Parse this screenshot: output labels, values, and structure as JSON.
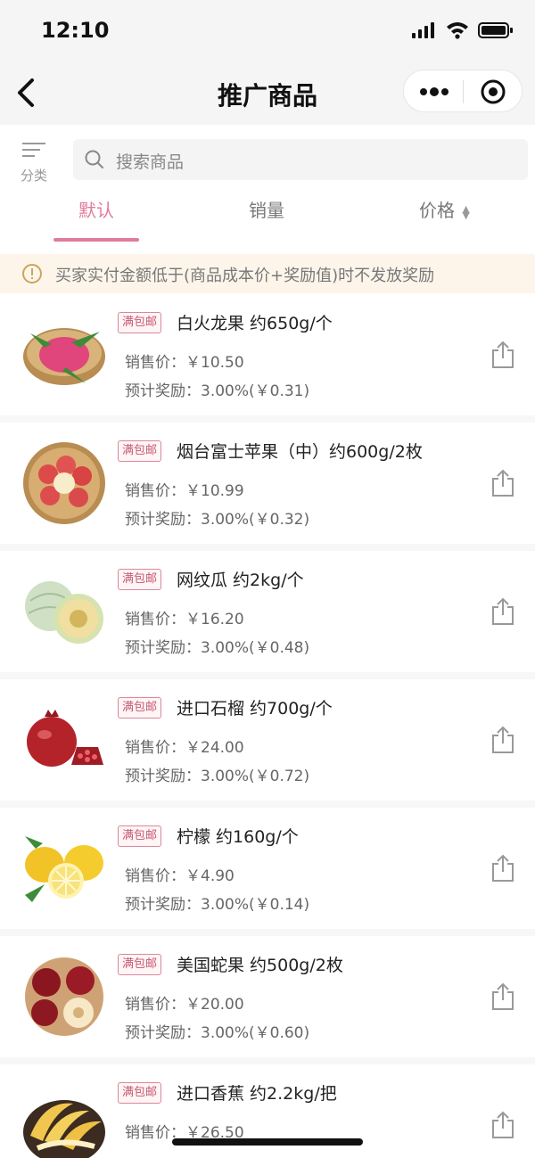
{
  "status_bar": {
    "time": "12:10"
  },
  "nav": {
    "title": "推广商品"
  },
  "filter": {
    "category_label": "分类",
    "search_placeholder": "搜索商品",
    "tabs": [
      {
        "label": "默认",
        "active": true
      },
      {
        "label": "销量",
        "active": false
      },
      {
        "label": "价格",
        "active": false
      }
    ]
  },
  "notice": {
    "text": "买家实付金额低于(商品成本价+奖励值)时不发放奖励"
  },
  "products": [
    {
      "badge": "满包邮",
      "name": "白火龙果 约650g/个",
      "price": "销售价：￥10.50",
      "reward": "预计奖励：3.00%(￥0.31)",
      "icon": "dragon-fruit-icon"
    },
    {
      "badge": "满包邮",
      "name": "烟台富士苹果（中）约600g/2枚",
      "price": "销售价：￥10.99",
      "reward": "预计奖励：3.00%(￥0.32)",
      "icon": "apple-basket-icon"
    },
    {
      "badge": "满包邮",
      "name": "网纹瓜 约2kg/个",
      "price": "销售价：￥16.20",
      "reward": "预计奖励：3.00%(￥0.48)",
      "icon": "melon-icon"
    },
    {
      "badge": "满包邮",
      "name": "进口石榴 约700g/个",
      "price": "销售价：￥24.00",
      "reward": "预计奖励：3.00%(￥0.72)",
      "icon": "pomegranate-icon"
    },
    {
      "badge": "满包邮",
      "name": "柠檬 约160g/个",
      "price": "销售价：￥4.90",
      "reward": "预计奖励：3.00%(￥0.14)",
      "icon": "lemon-icon"
    },
    {
      "badge": "满包邮",
      "name": "美国蛇果 约500g/2枚",
      "price": "销售价：￥20.00",
      "reward": "预计奖励：3.00%(￥0.60)",
      "icon": "red-apple-icon"
    },
    {
      "badge": "满包邮",
      "name": "进口香蕉 约2.2kg/把",
      "price": "销售价：￥26.50",
      "reward": "",
      "icon": "banana-icon"
    }
  ]
}
